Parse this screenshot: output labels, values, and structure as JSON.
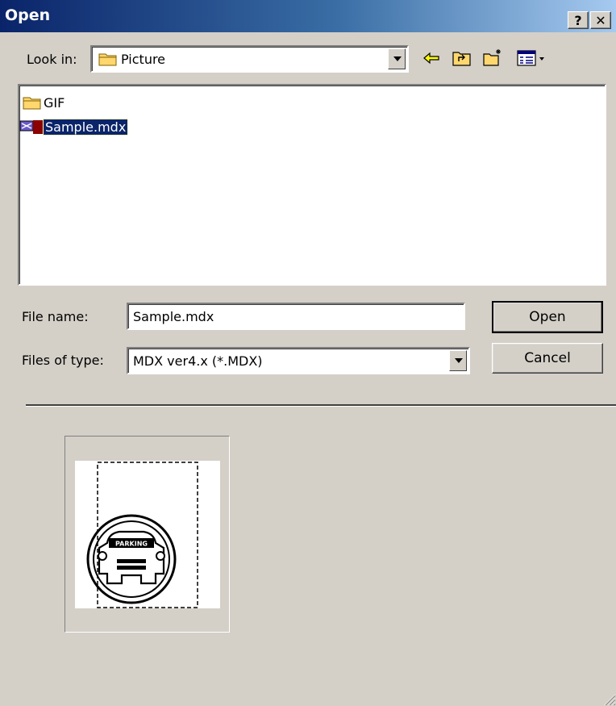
{
  "window": {
    "title": "Open",
    "help_label": "?",
    "close_label": "✕"
  },
  "look_in": {
    "label": "Look in:",
    "folder": "Picture"
  },
  "toolbar": {
    "icons": [
      "back-icon",
      "up-folder-icon",
      "new-folder-icon",
      "view-menu-icon"
    ]
  },
  "files": [
    {
      "name": "GIF",
      "type": "folder",
      "selected": false
    },
    {
      "name": "Sample.mdx",
      "type": "mdx-file",
      "selected": true
    }
  ],
  "filename": {
    "label": "File name:",
    "value": "Sample.mdx"
  },
  "filetype": {
    "label": "Files of type:",
    "value": "MDX ver4.x (*.MDX)"
  },
  "buttons": {
    "open": "Open",
    "cancel": "Cancel"
  },
  "preview": {
    "badge_text": "PARKING"
  },
  "colors": {
    "title_start": "#0a246a",
    "title_end": "#a6caf0",
    "selection": "#0a246a",
    "folder": "#ffd76e",
    "face": "#d4d0c8"
  }
}
